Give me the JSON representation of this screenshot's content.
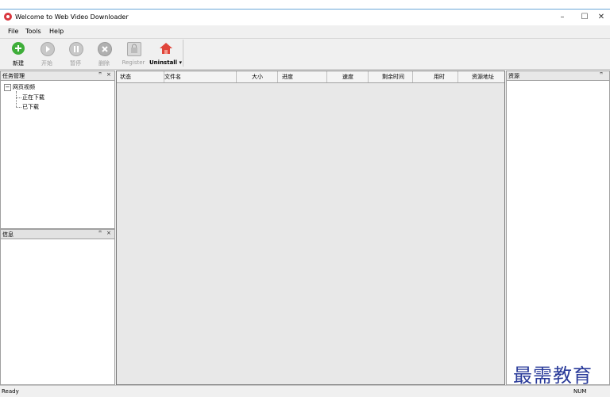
{
  "window": {
    "title": "Welcome to Web Video Downloader",
    "controls": {
      "minimize": "–",
      "maximize": "☐",
      "close": "✕"
    }
  },
  "menu": [
    "File",
    "Tools",
    "Help"
  ],
  "toolbar": {
    "buttons": [
      {
        "label": "新建",
        "icon": "add-icon",
        "enabled": true
      },
      {
        "label": "开始",
        "icon": "play-icon",
        "enabled": false
      },
      {
        "label": "暂停",
        "icon": "pause-icon",
        "enabled": false
      },
      {
        "label": "删除",
        "icon": "delete-icon",
        "enabled": false
      },
      {
        "label": "Register",
        "icon": "register-icon",
        "enabled": false
      },
      {
        "label": "Uninstall",
        "icon": "home-icon",
        "enabled": true,
        "dropdown": "▾"
      }
    ]
  },
  "task_panel": {
    "title": "任务管理",
    "pin": "ꟸ",
    "close": "×",
    "tree": {
      "toggle": "−",
      "root": "网页视频",
      "children": [
        "正在下载",
        "已下载"
      ]
    }
  },
  "info_panel": {
    "title": "信息",
    "pin": "ꟸ",
    "close": "×"
  },
  "grid": {
    "columns": [
      "状态",
      "文件名",
      "大小",
      "进度",
      "速度",
      "剩余时间",
      "用时",
      "资源地址"
    ]
  },
  "resource_panel": {
    "title": "资源",
    "pin": "ꟸ"
  },
  "status": {
    "left": "Ready",
    "right": "NUM"
  },
  "watermark": "最需教育",
  "colors": {
    "accent_line": "#6aa7d8",
    "add_green": "#3fae3a",
    "home_red": "#e0453a",
    "disabled_gray": "#b9b9b9",
    "watermark_blue": "#2a3b9a"
  }
}
